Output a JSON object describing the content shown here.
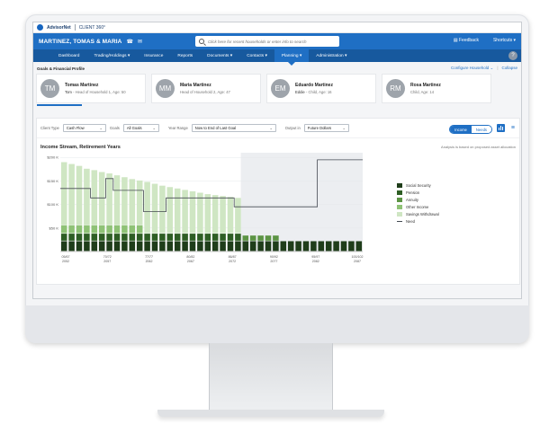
{
  "brand": {
    "name": "AdvisorNet",
    "product": "CLIENT 360°"
  },
  "header": {
    "household": "MARTINEZ, TOMAS & MARIA",
    "search_placeholder": "Click here for recent households or enter info to search",
    "feedback": "Feedback",
    "shortcuts": "Shortcuts"
  },
  "nav": {
    "items": [
      {
        "label": "Dashboard"
      },
      {
        "label": "Trading/Holdings ▾"
      },
      {
        "label": "Insurance"
      },
      {
        "label": "Reports"
      },
      {
        "label": "Documents ▾"
      },
      {
        "label": "Contacts ▾"
      },
      {
        "label": "Planning ▾",
        "active": true
      },
      {
        "label": "Administration ▾"
      }
    ],
    "help": "?"
  },
  "goals": {
    "title": "Goals & Financial Profile",
    "configure": "Configure Household ⌄",
    "divider": "|",
    "collapse": "Collapse"
  },
  "members": [
    {
      "initials": "TM",
      "name": "Tomas Martinez",
      "nickname": "Tom",
      "desc": " - Head of Household 1, Age: 50"
    },
    {
      "initials": "MM",
      "name": "Maria Martinez",
      "nickname": "",
      "desc": "Head of Household 2, Age: 47"
    },
    {
      "initials": "EM",
      "name": "Eduardo Martinez",
      "nickname": "Eddie",
      "desc": " - Child, Age: 16"
    },
    {
      "initials": "RM",
      "name": "Rosa Martinez",
      "nickname": "",
      "desc": "Child, Age: 14"
    }
  ],
  "controls": {
    "client_type_label": "Client Type",
    "client_type_value": "Cash Flow",
    "goals_label": "Goals",
    "goals_value": "All Goals",
    "year_range_label": "Year Range",
    "year_range_value": "Now to End of Last Goal",
    "output_label": "Output in",
    "output_value": "Future Dollars",
    "toggle_income": "Income",
    "toggle_needs": "Needs",
    "list_view_glyph": "≡"
  },
  "chart_title": "Income Stream, Retirement Years",
  "chart_note": "Analysis is based on proposed asset allocation",
  "colors": {
    "social_security": "#1f3d1a",
    "pension": "#2e5e24",
    "annuity": "#5c9444",
    "other_income": "#8fc276",
    "savings": "#cfe6c3",
    "need": "#444a52",
    "accent": "#1f6fc4"
  },
  "chart_data": {
    "type": "bar",
    "stacked": true,
    "title": "Income Stream, Retirement Years",
    "ylabels": [
      "$200 K",
      "$150 K",
      "$100 K",
      "$50 K"
    ],
    "ylim": [
      0,
      210
    ],
    "xticks": [
      {
        "top": "05/67",
        "bottom": "2052"
      },
      {
        "top": "70/72",
        "bottom": "2057"
      },
      {
        "top": "77/77",
        "bottom": "2062"
      },
      {
        "top": "80/82",
        "bottom": "2067"
      },
      {
        "top": "86/87",
        "bottom": "2072"
      },
      {
        "top": "90/92",
        "bottom": "2077"
      },
      {
        "top": "95/97",
        "bottom": "2082"
      },
      {
        "top": "100/102",
        "bottom": "2087"
      }
    ],
    "legend": [
      "Social Security",
      "Pension",
      "Annuity",
      "Other Income",
      "Savings Withdrawal",
      "Need"
    ],
    "social_security": [
      22,
      22,
      22,
      22,
      22,
      22,
      22,
      22,
      22,
      22,
      22,
      22,
      22,
      22,
      22,
      22,
      22,
      22,
      22,
      22,
      22,
      22,
      22,
      22,
      22,
      22,
      22,
      22,
      22,
      22,
      22,
      22,
      22,
      22,
      22,
      22,
      22,
      22,
      22,
      22
    ],
    "pension": [
      16,
      16,
      16,
      16,
      16,
      16,
      16,
      16,
      16,
      16,
      16,
      16,
      16,
      16,
      16,
      16,
      16,
      16,
      16,
      16,
      16,
      16,
      16,
      16,
      0,
      0,
      0,
      0,
      0,
      0,
      0,
      0,
      0,
      0,
      0,
      0,
      0,
      0,
      0,
      0
    ],
    "annuity": [
      0,
      0,
      0,
      0,
      0,
      0,
      0,
      0,
      0,
      0,
      0,
      0,
      0,
      0,
      0,
      0,
      0,
      0,
      0,
      0,
      0,
      0,
      0,
      0,
      12,
      12,
      12,
      12,
      12,
      0,
      0,
      0,
      0,
      0,
      0,
      0,
      0,
      0,
      0,
      0
    ],
    "other_income": [
      18,
      18,
      18,
      18,
      18,
      18,
      18,
      18,
      18,
      18,
      18,
      0,
      0,
      0,
      0,
      0,
      0,
      0,
      0,
      0,
      0,
      0,
      0,
      0,
      0,
      0,
      0,
      0,
      0,
      0,
      0,
      0,
      0,
      0,
      0,
      0,
      0,
      0,
      0,
      0
    ],
    "savings": [
      134,
      130,
      126,
      120,
      117,
      113,
      110,
      106,
      102,
      98,
      95,
      110,
      106,
      102,
      99,
      96,
      93,
      90,
      87,
      84,
      82,
      80,
      78,
      76,
      0,
      0,
      0,
      0,
      0,
      0,
      0,
      0,
      0,
      0,
      0,
      0,
      0,
      0,
      0,
      0
    ],
    "need": [
      134,
      134,
      134,
      134,
      114,
      114,
      155,
      130,
      130,
      130,
      130,
      85,
      85,
      85,
      114,
      114,
      114,
      114,
      114,
      114,
      114,
      114,
      114,
      95,
      95,
      95,
      95,
      95,
      95,
      95,
      95,
      95,
      95,
      95,
      195,
      195,
      195,
      195,
      195,
      195
    ]
  }
}
